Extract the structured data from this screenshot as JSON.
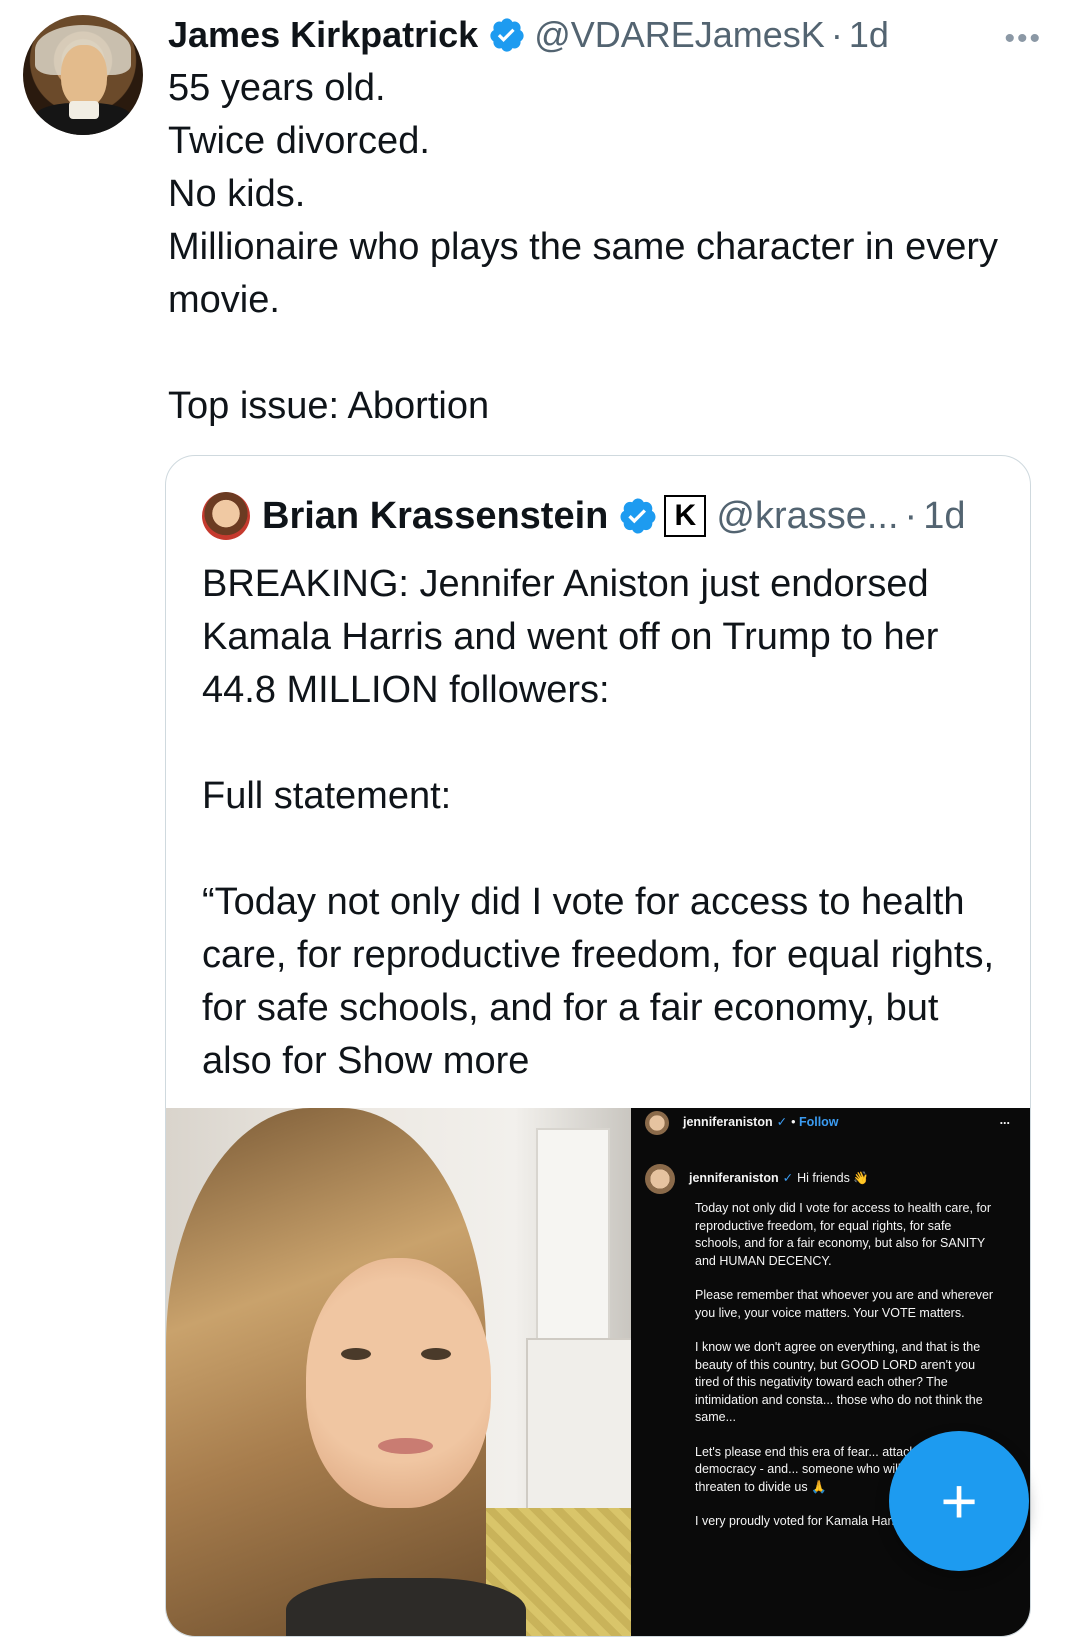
{
  "tweet": {
    "author_name": "James Kirkpatrick",
    "handle": "@VDAREJamesK",
    "separator": "·",
    "time": "1d",
    "more": "•••",
    "lines": [
      "55 years old.",
      "Twice divorced.",
      "No kids.",
      "Millionaire who plays the same character in every movie.",
      "",
      "Top issue: Abortion"
    ]
  },
  "quote": {
    "author_name": "Brian Krassenstein",
    "badge_letter": "K",
    "handle": "@krasse...",
    "separator": "·",
    "time": "1d",
    "text": "BREAKING: Jennifer Aniston just endorsed Kamala Harris and went off on Trump to her 44.8 MILLION followers:\n\nFull statement:\n\n“Today not only did I vote for access to health care, for reproductive freedom, for equal rights, for safe schools, and for a fair economy, but also for ",
    "show_more": "Show more"
  },
  "instagram": {
    "username": "jenniferaniston",
    "check": "✓",
    "dot": "•",
    "follow": "Follow",
    "more": "...",
    "greeting": "Hi friends 👋",
    "paragraphs": [
      "Today not only did I vote for access to health care, for reproductive freedom, for equal rights, for safe schools, and for a fair economy, but also for SANITY and HUMAN DECENCY.",
      "Please remember that whoever you are and wherever you live, your voice matters. Your VOTE matters.",
      "I know we don't agree on everything, and that is the beauty of this country, but GOOD LORD aren't you tired of this negativity toward each other? The intimidation and consta... those who do not think the same...",
      "Let's please end this era of fear... attacks on our democracy - and... someone who will unite us and n... threaten to divide us 🙏",
      "I very proudly voted for Kamala Harris and Tim"
    ]
  },
  "fab": {
    "label": "+"
  }
}
